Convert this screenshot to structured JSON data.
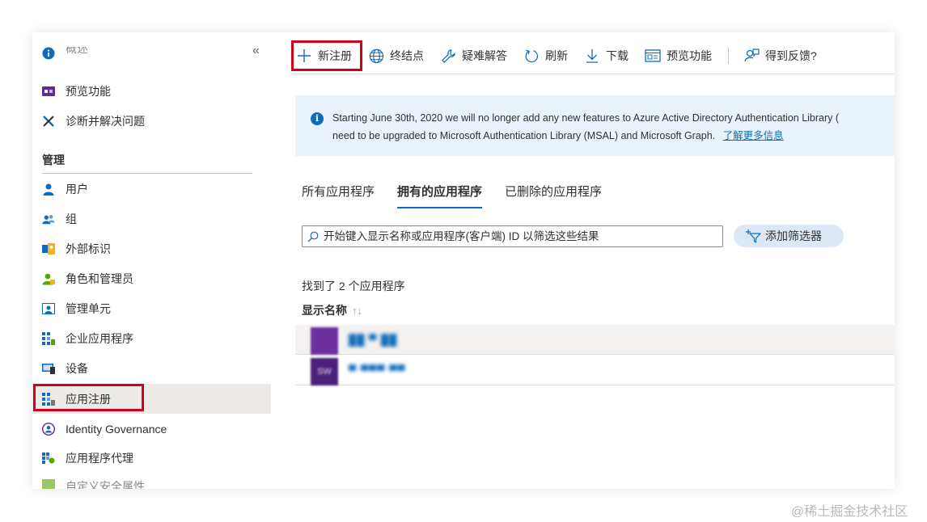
{
  "sidebar": {
    "collapse_label": "«",
    "items_top": [
      {
        "label": "概述",
        "icon": "info-icon"
      },
      {
        "label": "预览功能",
        "icon": "preview-features-icon"
      },
      {
        "label": "诊断并解决问题",
        "icon": "wrench-cross-icon"
      }
    ],
    "section_title": "管理",
    "items": [
      {
        "label": "用户",
        "icon": "user-icon"
      },
      {
        "label": "组",
        "icon": "group-icon"
      },
      {
        "label": "外部标识",
        "icon": "external-identity-icon"
      },
      {
        "label": "角色和管理员",
        "icon": "roles-icon"
      },
      {
        "label": "管理单元",
        "icon": "admin-unit-icon"
      },
      {
        "label": "企业应用程序",
        "icon": "enterprise-apps-icon"
      },
      {
        "label": "设备",
        "icon": "device-icon"
      },
      {
        "label": "应用注册",
        "icon": "app-registration-icon"
      },
      {
        "label": "Identity Governance",
        "icon": "governance-icon"
      },
      {
        "label": "应用程序代理",
        "icon": "app-proxy-icon"
      },
      {
        "label": "自定义安全属性",
        "icon": "security-attributes-icon"
      }
    ],
    "active_item": "应用注册"
  },
  "toolbar": {
    "new_registration": "新注册",
    "endpoints": "终结点",
    "troubleshoot": "疑难解答",
    "refresh": "刷新",
    "download": "下载",
    "preview_features": "预览功能",
    "feedback": "得到反馈?"
  },
  "banner": {
    "line1": "Starting June 30th, 2020 we will no longer add any new features to Azure Active Directory Authentication Library (",
    "line2": "need to be upgraded to Microsoft Authentication Library (MSAL) and Microsoft Graph.",
    "link": "了解更多信息"
  },
  "tabs": [
    {
      "label": "所有应用程序",
      "active": false
    },
    {
      "label": "拥有的应用程序",
      "active": true
    },
    {
      "label": "已删除的应用程序",
      "active": false
    }
  ],
  "search": {
    "placeholder": "开始键入显示名称或应用程序(客户端) ID 以筛选这些结果"
  },
  "add_filter": "添加筛选器",
  "results_text": "找到了 2 个应用程序",
  "column_header": "显示名称",
  "sort_indicator": "↑↓",
  "apps": [
    {
      "initials": "",
      "name": "██ ▀ ██"
    },
    {
      "initials": "SW",
      "name": "▀ ▀▀▀ ▀▀"
    }
  ],
  "watermark": "@稀土掘金技术社区",
  "colors": {
    "accent": "#0f6cbd",
    "highlight_border": "#d0021b",
    "banner_bg": "#eaf2fb",
    "active_nav": "#edebe9"
  }
}
